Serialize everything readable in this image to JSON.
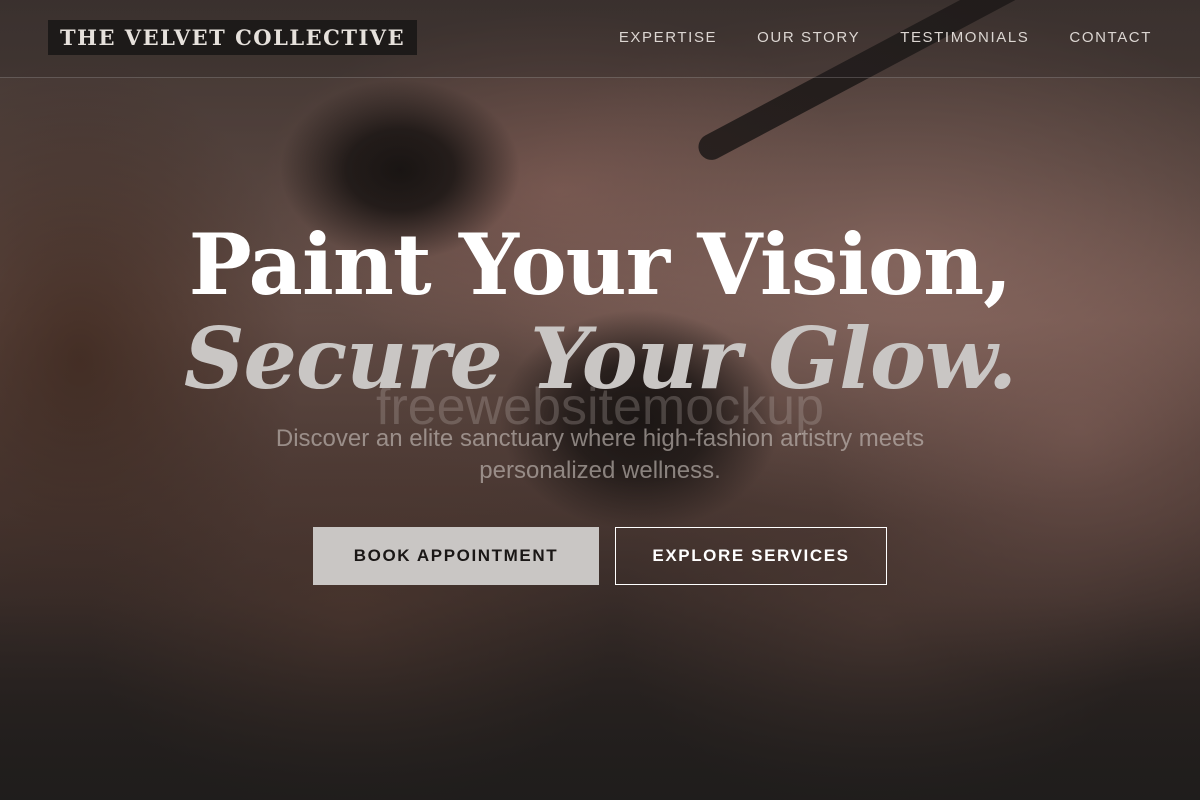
{
  "brand": {
    "name": "THE VELVET COLLECTIVE"
  },
  "nav": {
    "items": [
      {
        "label": "EXPERTISE"
      },
      {
        "label": "OUR STORY"
      },
      {
        "label": "TESTIMONIALS"
      },
      {
        "label": "CONTACT"
      }
    ]
  },
  "hero": {
    "headline_line1": "Paint Your Vision,",
    "headline_line2": "Secure Your Glow.",
    "watermark": "freewebsitemockup",
    "subheading": "Discover an elite sanctuary where high-fashion artistry meets personalized wellness.",
    "primary_cta": "BOOK APPOINTMENT",
    "secondary_cta": "EXPLORE SERVICES"
  }
}
